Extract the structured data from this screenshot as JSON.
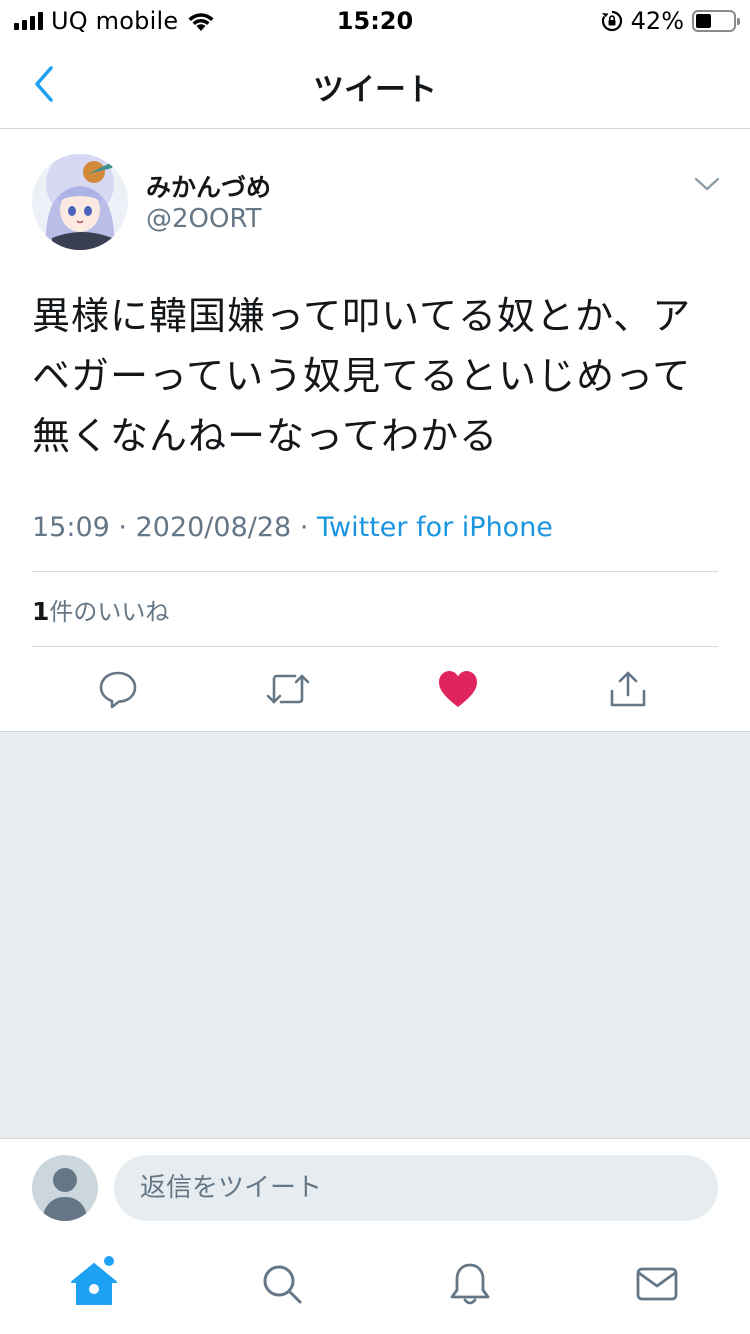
{
  "status_bar": {
    "carrier": "UQ mobile",
    "time": "15:20",
    "battery_percent": "42%",
    "battery_level": 0.42,
    "icons": [
      "signal-icon",
      "wifi-icon",
      "orientation-lock-icon",
      "battery-icon"
    ]
  },
  "nav": {
    "title": "ツイート",
    "back_icon": "chevron-left-icon"
  },
  "tweet": {
    "display_name": "みかんづめ",
    "handle": "@2OORT",
    "text": "異様に韓国嫌って叩いてる奴とか、アベガーっていう奴見てるといじめって無くなんねーなってわかる",
    "time": "15:09",
    "separator": "·",
    "date": "2020/08/28",
    "source": "Twitter for iPhone",
    "likes_count": "1",
    "likes_label": "件のいいね",
    "liked": true,
    "action_icons": [
      "reply-icon",
      "retweet-icon",
      "like-icon",
      "share-icon"
    ]
  },
  "reply": {
    "placeholder": "返信をツイート"
  },
  "tab_bar": {
    "tabs": [
      "home-icon",
      "search-icon",
      "notifications-icon",
      "messages-icon"
    ],
    "home_has_badge": true
  },
  "colors": {
    "accent": "#1da1f2",
    "link": "#1b95e0",
    "like": "#e0245e",
    "secondary_text": "#657786",
    "background_fill": "#e6ecf0"
  }
}
